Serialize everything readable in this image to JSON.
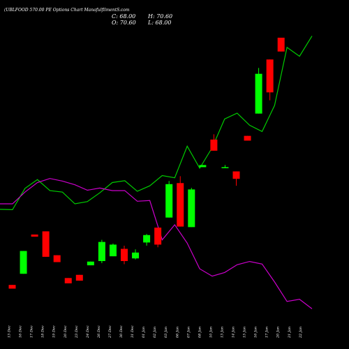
{
  "title": "(UBLFOOD 570.00 PE Options Chart ManafulfilmentS.com",
  "ohlc": {
    "close": "C: 68.00",
    "high": "H: 70.60",
    "open": "O: 70.60",
    "low": "L: 68.00"
  },
  "chart_data": {
    "type": "candlestick",
    "title": "(UBLFOOD 570.00 PE Options Chart ManafulfilmentS.com",
    "colors": {
      "up": "#00ff00",
      "down": "#ff0000",
      "line_green": "#00cc00",
      "line_magenta": "#cc00cc",
      "background": "#000000"
    },
    "grid": false,
    "categories": [
      "13 Dec",
      "16 Dec",
      "17 Dec",
      "18 Dec",
      "19 Dec",
      "20 Dec",
      "23 Dec",
      "24 Dec",
      "26 Dec",
      "27 Dec",
      "30 Dec",
      "31 Dec",
      "01 Jan",
      "02 Jan",
      "03 Jan",
      "06 Jan",
      "07 Jan",
      "08 Jan",
      "10 Jan",
      "13 Jan",
      "14 Jan",
      "15 Jan",
      "16 Jan",
      "17 Jan",
      "20 Jan",
      "21 Jan",
      "22 Jan"
    ],
    "candles": [
      {
        "o": 24.0,
        "h": 24.0,
        "l": 23.3,
        "c": 23.3
      },
      {
        "o": 26.1,
        "h": 30.4,
        "l": 26.1,
        "c": 30.4
      },
      {
        "o": 33.5,
        "h": 33.5,
        "l": 33.1,
        "c": 33.1
      },
      {
        "o": 34.1,
        "h": 34.1,
        "l": 29.3,
        "c": 29.3
      },
      {
        "o": 29.6,
        "h": 29.6,
        "l": 28.3,
        "c": 28.3
      },
      {
        "o": 25.3,
        "h": 25.3,
        "l": 24.3,
        "c": 24.3
      },
      {
        "o": 25.9,
        "h": 25.9,
        "l": 24.8,
        "c": 24.8
      },
      {
        "o": 27.7,
        "h": 28.4,
        "l": 27.7,
        "c": 28.4
      },
      {
        "o": 28.5,
        "h": 32.5,
        "l": 28.1,
        "c": 32.1
      },
      {
        "o": 29.4,
        "h": 31.8,
        "l": 29.4,
        "c": 31.6
      },
      {
        "o": 30.8,
        "h": 31.4,
        "l": 27.9,
        "c": 28.5
      },
      {
        "o": 29.0,
        "h": 30.7,
        "l": 28.8,
        "c": 30.1
      },
      {
        "o": 32.0,
        "h": 33.6,
        "l": 31.4,
        "c": 33.4
      },
      {
        "o": 34.8,
        "h": 34.8,
        "l": 31.1,
        "c": 31.6
      },
      {
        "o": 36.7,
        "h": 43.6,
        "l": 36.7,
        "c": 43.0
      },
      {
        "o": 43.2,
        "h": 44.5,
        "l": 35.0,
        "c": 35.0
      },
      {
        "o": 34.9,
        "h": 42.3,
        "l": 34.9,
        "c": 42.0
      },
      {
        "o": 46.2,
        "h": 46.6,
        "l": 46.2,
        "c": 46.6
      },
      {
        "o": 51.4,
        "h": 52.4,
        "l": 49.3,
        "c": 49.3
      },
      {
        "o": 46.2,
        "h": 46.6,
        "l": 46.2,
        "c": 46.2
      },
      {
        "o": 45.4,
        "h": 45.4,
        "l": 42.7,
        "c": 44.0
      },
      {
        "o": 52.1,
        "h": 52.1,
        "l": 51.2,
        "c": 51.2
      },
      {
        "o": 56.3,
        "h": 64.9,
        "l": 56.3,
        "c": 63.8
      },
      {
        "o": 66.5,
        "h": 66.5,
        "l": 58.8,
        "c": 60.3
      },
      {
        "o": 70.6,
        "h": 70.6,
        "l": 68.0,
        "c": 68.0
      }
    ],
    "series": [
      {
        "name": "",
        "color": "#00cc00",
        "values": [
          133.1,
          133.0,
          138.8,
          141.2,
          138.2,
          137.8,
          134.6,
          135.2,
          137.6,
          140.4,
          140.9,
          138.0,
          139.5,
          142.3,
          141.7,
          150.3,
          144.3,
          149.9,
          157.7,
          159.3,
          156.0,
          154.3,
          161.4,
          177.2,
          174.8,
          180.3
        ]
      },
      {
        "name": "",
        "color": "#cc00cc",
        "values": [
          134.6,
          134.6,
          137.8,
          140.4,
          141.5,
          140.8,
          139.8,
          138.3,
          138.9,
          138.2,
          138.2,
          135.3,
          135.5,
          124.8,
          128.9,
          123.9,
          116.9,
          114.9,
          115.9,
          118.0,
          118.9,
          118.2,
          113.3,
          108.0,
          108.6,
          106.0
        ]
      }
    ]
  }
}
